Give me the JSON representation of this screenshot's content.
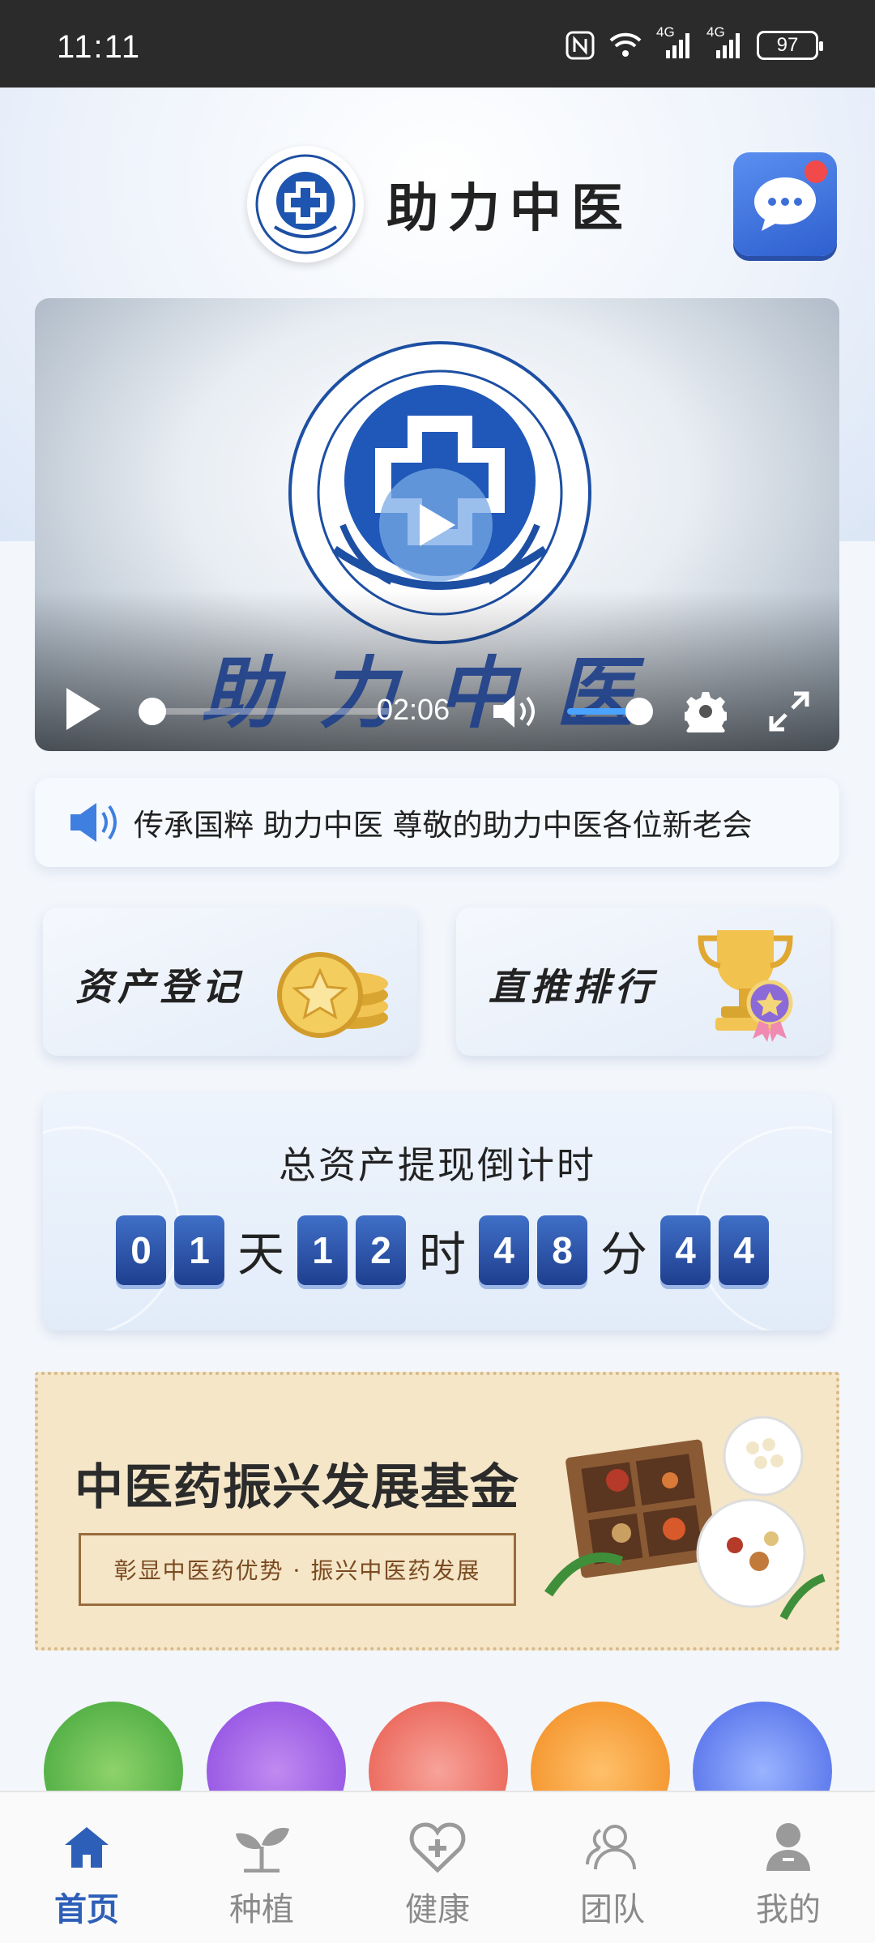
{
  "status_bar": {
    "time": "11:11",
    "network_1": "4G",
    "network_2": "4G",
    "battery": "97"
  },
  "header": {
    "title": "助力中医"
  },
  "video": {
    "wordmark": "助力中医",
    "time": "02:06",
    "progress": 0.0,
    "volume": 1.0
  },
  "notice": {
    "text": "传承国粹 助力中医 尊敬的助力中医各位新老会"
  },
  "cards": [
    {
      "label": "资产登记"
    },
    {
      "label": "直推排行"
    }
  ],
  "countdown": {
    "title": "总资产提现倒计时",
    "days": [
      "0",
      "1"
    ],
    "day_unit": "天",
    "hours": [
      "1",
      "2"
    ],
    "hour_unit": "时",
    "minutes": [
      "4",
      "8"
    ],
    "minute_unit": "分",
    "seconds": [
      "4",
      "4"
    ]
  },
  "banner": {
    "title": "中医药振兴发展基金",
    "subtitle": "彰显中医药优势 · 振兴中医药发展"
  },
  "colors": {
    "accent": "#2e5fb8",
    "nav_inactive": "#8a8a8a",
    "notification_dot": "#f24a4a"
  },
  "bottom_nav": [
    {
      "label": "首页",
      "icon": "home-icon",
      "active": true
    },
    {
      "label": "种植",
      "icon": "sprout-icon",
      "active": false
    },
    {
      "label": "健康",
      "icon": "heart-plus-icon",
      "active": false
    },
    {
      "label": "团队",
      "icon": "team-icon",
      "active": false
    },
    {
      "label": "我的",
      "icon": "user-icon",
      "active": false
    }
  ]
}
